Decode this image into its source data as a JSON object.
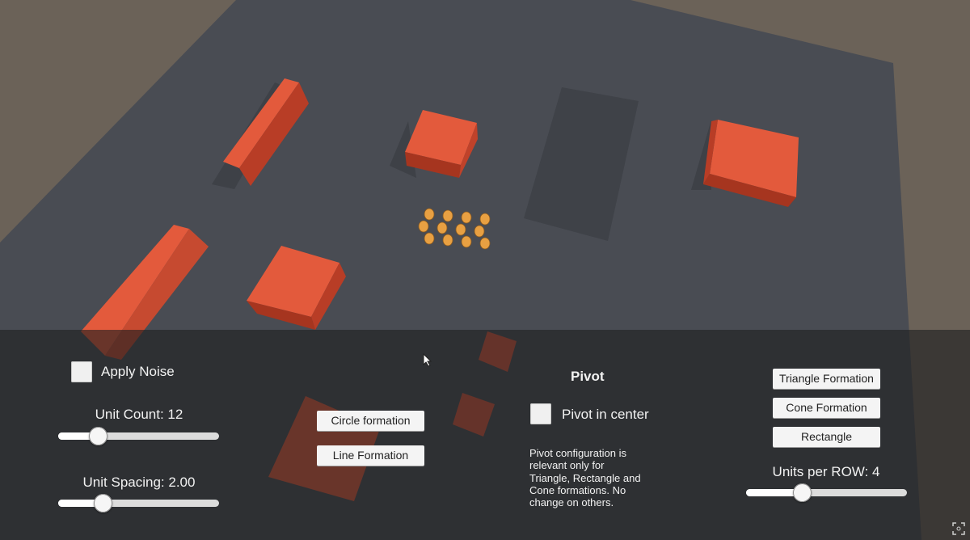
{
  "noise": {
    "label": "Apply Noise",
    "checked": false
  },
  "unit_count": {
    "label": "Unit Count: 12",
    "value": 12,
    "min": 1,
    "max": 100,
    "fraction": 0.25
  },
  "unit_spacing": {
    "label": "Unit Spacing: 2.00",
    "value": 2.0,
    "fraction": 0.28
  },
  "formations_left": {
    "circle": "Circle formation",
    "line": "Line Formation"
  },
  "pivot": {
    "heading": "Pivot",
    "checkbox_label": "Pivot in center",
    "checked": false,
    "note_lines": [
      "Pivot configuration is",
      "relevant only for",
      "Triangle, Rectangle and",
      "Cone formations. No",
      "change on others."
    ]
  },
  "formations_right": {
    "triangle": "Triangle Formation",
    "cone": "Cone Formation",
    "rectangle": "Rectangle"
  },
  "units_per_row": {
    "label": "Units per ROW: 4",
    "value": 4,
    "fraction": 0.35
  },
  "colors": {
    "ground": "#4a4d54",
    "sky": "#6b6258",
    "block": "#e35a3c",
    "unit": "#e8a042",
    "panel": "#1e1e20"
  },
  "icons": {
    "cursor": "mouse-pointer-icon",
    "fullscreen": "fullscreen-icon"
  }
}
